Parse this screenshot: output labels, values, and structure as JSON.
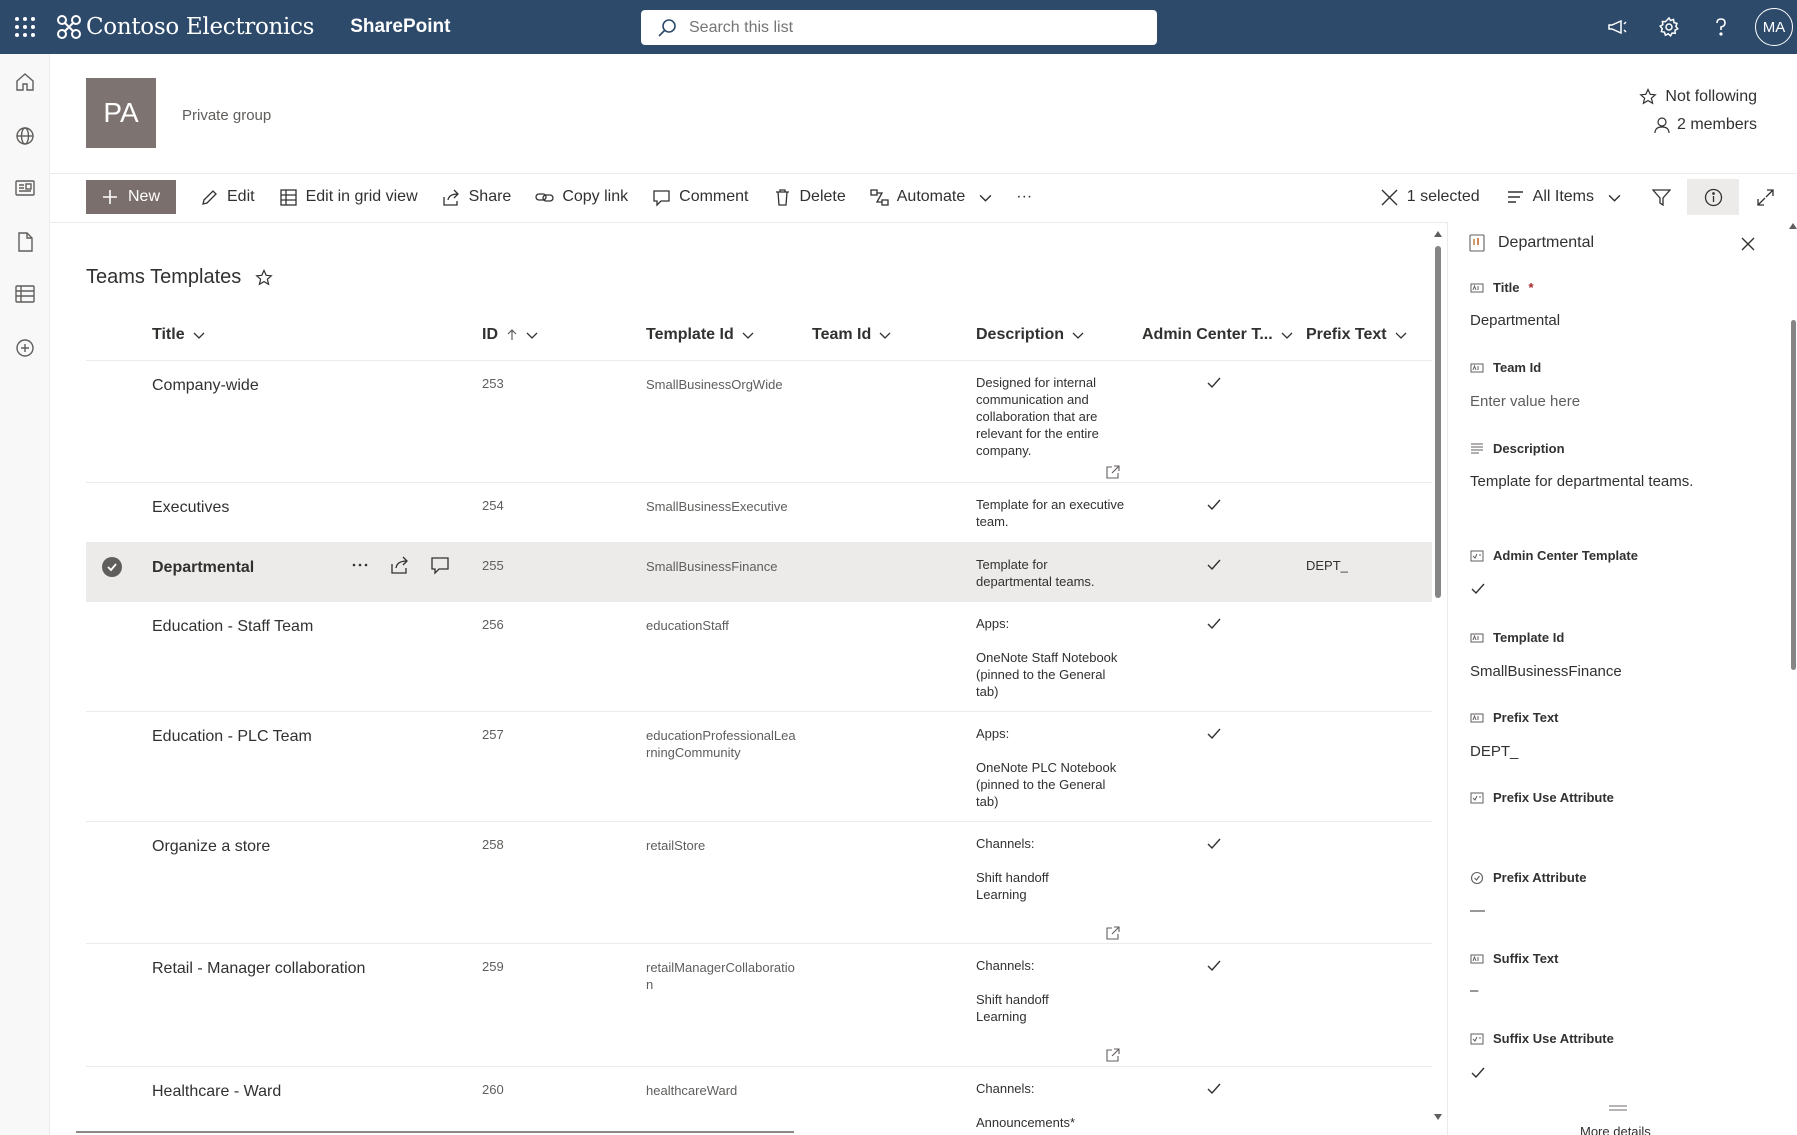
{
  "suite": {
    "brand": "Contoso Electronics",
    "app": "SharePoint",
    "search_placeholder": "Search this list",
    "user_initials": "MA"
  },
  "site": {
    "logo_initials": "PA",
    "privacy": "Private group",
    "follow_label": "Not following",
    "members_label": "2 members"
  },
  "commands": {
    "new": "New",
    "edit": "Edit",
    "grid": "Edit in grid view",
    "share": "Share",
    "copy_link": "Copy link",
    "comment": "Comment",
    "delete": "Delete",
    "automate": "Automate",
    "more": "···",
    "selected": "1 selected",
    "view": "All Items"
  },
  "list": {
    "title": "Teams Templates",
    "columns": {
      "title": "Title",
      "id": "ID",
      "template_id": "Template Id",
      "team_id": "Team Id",
      "description": "Description",
      "admin": "Admin Center T...",
      "prefix": "Prefix Text"
    },
    "rows": [
      {
        "title": "Company-wide",
        "id": "253",
        "template_id": "SmallBusinessOrgWide",
        "description": "Designed for internal communication and collaboration that are relevant for the entire company.",
        "admin": true,
        "prefix": "",
        "selected": false
      },
      {
        "title": "Executives",
        "id": "254",
        "template_id": "SmallBusinessExecutive",
        "description": "Template for an executive team.",
        "admin": true,
        "prefix": "",
        "selected": false
      },
      {
        "title": "Departmental",
        "id": "255",
        "template_id": "SmallBusinessFinance",
        "description": "Template for departmental teams.",
        "admin": true,
        "prefix": "DEPT_",
        "selected": true
      },
      {
        "title": "Education - Staff Team",
        "id": "256",
        "template_id": "educationStaff",
        "description": "Apps:\n\nOneNote Staff Notebook (pinned to the General tab)",
        "admin": true,
        "prefix": "",
        "selected": false
      },
      {
        "title": "Education - PLC Team",
        "id": "257",
        "template_id": "educationProfessionalLearningCommunity",
        "description": "Apps:\n\nOneNote PLC Notebook (pinned to the General tab)",
        "admin": true,
        "prefix": "",
        "selected": false
      },
      {
        "title": "Organize a store",
        "id": "258",
        "template_id": "retailStore",
        "description": "Channels:\n\nShift handoff\nLearning",
        "admin": true,
        "prefix": "",
        "selected": false
      },
      {
        "title": "Retail - Manager collaboration",
        "id": "259",
        "template_id": "retailManagerCollaboration",
        "description": "Channels:\n\nShift handoff\nLearning",
        "admin": true,
        "prefix": "",
        "selected": false
      },
      {
        "title": "Healthcare - Ward",
        "id": "260",
        "template_id": "healthcareWard",
        "description": "Channels:\n\nAnnouncements*",
        "admin": true,
        "prefix": "",
        "selected": false
      }
    ]
  },
  "pane": {
    "title": "Departmental",
    "fields": {
      "title_label": "Title",
      "title_required": "*",
      "title_value": "Departmental",
      "team_id_label": "Team Id",
      "team_id_placeholder": "Enter value here",
      "description_label": "Description",
      "description_value": "Template for departmental teams.",
      "admin_label": "Admin Center Template",
      "template_id_label": "Template Id",
      "template_id_value": "SmallBusinessFinance",
      "prefix_label": "Prefix Text",
      "prefix_value": "DEPT_",
      "prefix_use_label": "Prefix Use Attribute",
      "prefix_attr_label": "Prefix Attribute",
      "prefix_attr_value": "—",
      "suffix_label": "Suffix Text",
      "suffix_value": "–",
      "suffix_use_label": "Suffix Use Attribute"
    },
    "more_details": "More details"
  },
  "colors": {
    "suitebar": "#2d4a6b",
    "new_button": "#7a6f6c",
    "selected_row": "#edebe9",
    "site_logo": "#7d7471"
  }
}
